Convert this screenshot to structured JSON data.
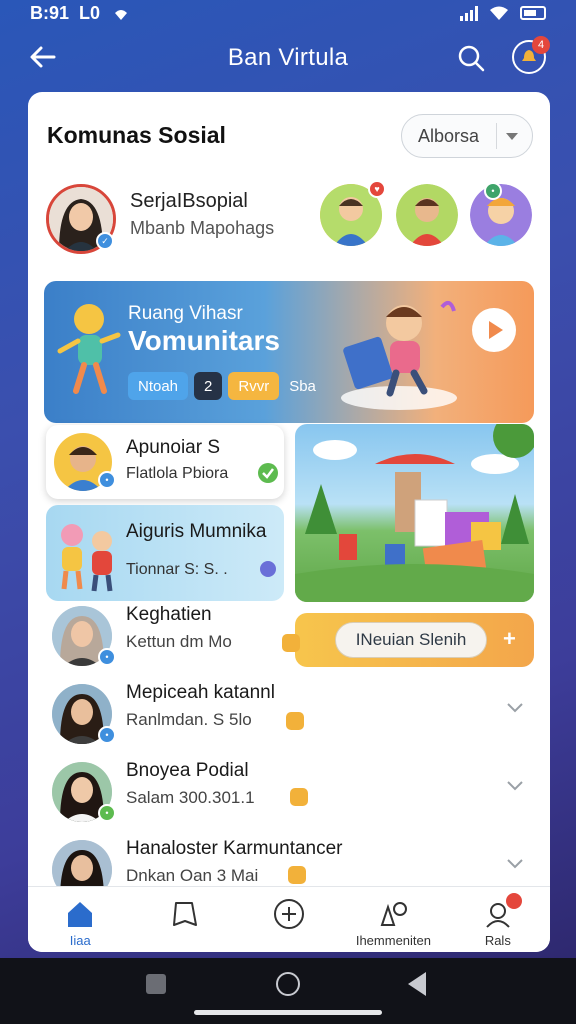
{
  "status_bar": {
    "time": "B:91",
    "carrier_glyph": "L0"
  },
  "header": {
    "title": "Ban Virtula"
  },
  "card": {
    "title": "Komunas Sosial",
    "filter": {
      "selected": "Alborsa"
    }
  },
  "profile": {
    "name": "SerjaIBsopial",
    "subtitle": "Mbanb Mapohags"
  },
  "banner": {
    "small": "Ruang Vihasr",
    "big": "Vomunitars",
    "chips": [
      "Ntoah",
      "2",
      "Rvvr"
    ],
    "chip_trailing": "Sba"
  },
  "tiles": [
    {
      "title": "Apunoiar S",
      "subtitle": "Flatlola Pbiora"
    },
    {
      "title": "Aiguris Mumnika",
      "subtitle": "Tionnar S: S. ."
    }
  ],
  "cta": {
    "label": "INeuian Slenih",
    "plus": "+"
  },
  "list": [
    {
      "name": "Keghatien",
      "subtitle": "Kettun dm Mo"
    },
    {
      "name": "Mepiceah katannl",
      "subtitle": "Ranlmdan. S 5lo"
    },
    {
      "name": "Bnoyea Podial",
      "subtitle": "Salam 300.301.1"
    },
    {
      "name": "Hanaloster Karmuntancer",
      "subtitle": "Dnkan Oan 3 Mai"
    }
  ],
  "nav": [
    {
      "label": "Iiaa",
      "icon": "home-icon",
      "active": true
    },
    {
      "label": "",
      "icon": "bookmark-icon",
      "active": false
    },
    {
      "label": "",
      "icon": "add-circle-icon",
      "active": false
    },
    {
      "label": "Ihemmeniten",
      "icon": "settings-icon",
      "active": false
    },
    {
      "label": "Rals",
      "icon": "profile-icon",
      "active": false
    }
  ],
  "colors": {
    "accent": "#2b6ccc",
    "badge_red": "#e4473c",
    "cta_yellow": "#f7c54c"
  }
}
